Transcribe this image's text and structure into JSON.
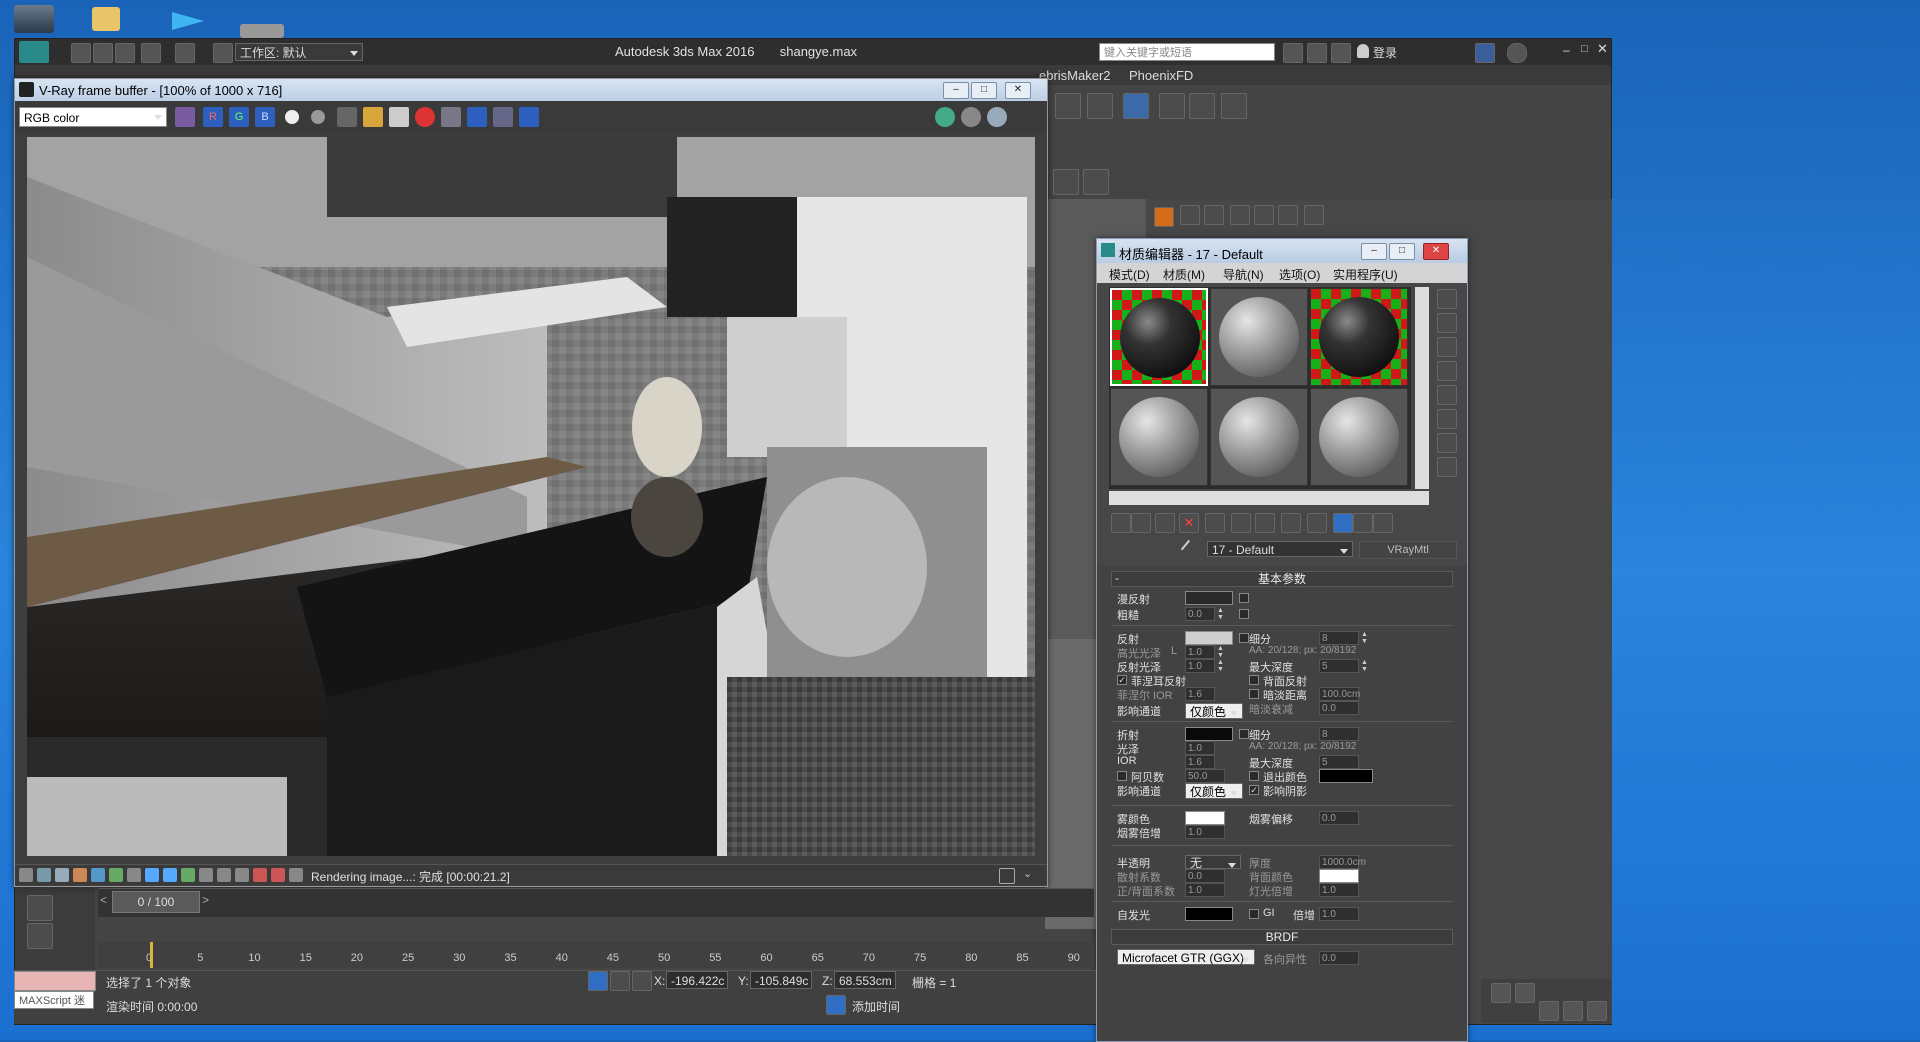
{
  "desktop": {
    "icons": [
      "desktop-icon-1",
      "desktop-icon-2",
      "desktop-icon-3",
      "desktop-icon-4"
    ]
  },
  "max_window": {
    "title": "Autodesk 3ds Max 2016",
    "file": "shangye.max",
    "workspace": "工作区: 默认",
    "search_placeholder": "键入关键字或短语",
    "login": "登录",
    "menu_extras": [
      "ebrisMaker2",
      "PhoenixFD"
    ]
  },
  "vfb": {
    "title": "V-Ray frame buffer - [100% of 1000 x 716]",
    "channel": "RGB color",
    "channel_buttons": [
      "R",
      "G",
      "B"
    ],
    "status": "Rendering image...: 完成 [00:00:21.2]"
  },
  "material_editor": {
    "title": "材质编辑器 - 17 - Default",
    "menus": [
      "模式(D)",
      "材质(M)",
      "导航(N)",
      "选项(O)",
      "实用程序(U)"
    ],
    "material_name": "17 - Default",
    "material_type": "VRayMtl",
    "rollout_basic": "基本参数",
    "rollout_brdf": "BRDF",
    "brdf_type": "Microfacet GTR (GGX)",
    "brdf_label": "各向异性",
    "brdf_value": "0.0",
    "diffuse": {
      "label": "漫反射",
      "roughness_label": "粗糙",
      "roughness": "0.0"
    },
    "reflection": {
      "label": "反射",
      "hilight_label": "高光光泽",
      "hilight": "1.0",
      "lock": "L",
      "gloss_label": "反射光泽",
      "gloss": "1.0",
      "fresnel_label": "菲涅耳反射",
      "fresnel_ior_label": "菲涅尔 IOR",
      "fresnel_ior": "1.6",
      "affect_label": "影响通道",
      "affect": "仅颜色",
      "subdivs_label": "细分",
      "subdivs": "8",
      "aa": "AA: 20/128; px: 20/8192",
      "maxdepth_label": "最大深度",
      "maxdepth": "5",
      "backside_label": "背面反射",
      "dimdist_label": "暗淡距离",
      "dimdist": "100.0cm",
      "dimfall_label": "暗淡衰减",
      "dimfall": "0.0"
    },
    "refraction": {
      "label": "折射",
      "gloss_label": "光泽",
      "gloss": "1.0",
      "ior_label": "IOR",
      "ior": "1.6",
      "abbe_label": "阿贝数",
      "abbe": "50.0",
      "affect_label": "影响通道",
      "affect": "仅颜色",
      "subdivs_label": "细分",
      "subdivs": "8",
      "aa": "AA: 20/128; px: 20/8192",
      "maxdepth_label": "最大深度",
      "maxdepth": "5",
      "exit_label": "退出颜色",
      "shadows_label": "影响阴影"
    },
    "fog": {
      "color_label": "雾颜色",
      "mult_label": "烟雾倍增",
      "mult": "1.0",
      "bias_label": "烟雾偏移",
      "bias": "0.0"
    },
    "translucency": {
      "label": "半透明",
      "type": "无",
      "scatter_label": "散射系数",
      "scatter": "0.0",
      "fb_label": "正/背面系数",
      "fb": "1.0",
      "thick_label": "厚度",
      "thick": "1000.0cm",
      "back_label": "背面颜色",
      "light_label": "灯光倍增",
      "light": "1.0"
    },
    "self_illum": {
      "label": "自发光",
      "gi_label": "GI",
      "mult_label": "倍增",
      "mult": "1.0"
    }
  },
  "timeline": {
    "frame": "0 / 100",
    "prev": "<",
    "next": ">",
    "ticks": [
      "0",
      "5",
      "10",
      "15",
      "20",
      "25",
      "30",
      "35",
      "40",
      "45",
      "50",
      "55",
      "60",
      "65",
      "70",
      "75",
      "80",
      "85",
      "90"
    ]
  },
  "status_bar": {
    "maxscript": "MAXScript 迷",
    "selected": "选择了 1 个对象",
    "render_time": "渲染时间 0:00:00",
    "x_label": "X:",
    "x": "-196.422c",
    "y_label": "Y:",
    "y": "-105.849c",
    "z_label": "Z:",
    "z": "68.553cm",
    "grid": "栅格 = 1",
    "add_time": "添加时间"
  },
  "colors": {
    "desktop": "#1f6fcf",
    "max_bg": "#444444",
    "title_gradient": "#c9d8ec",
    "accent_blue": "#2f6ec2"
  }
}
